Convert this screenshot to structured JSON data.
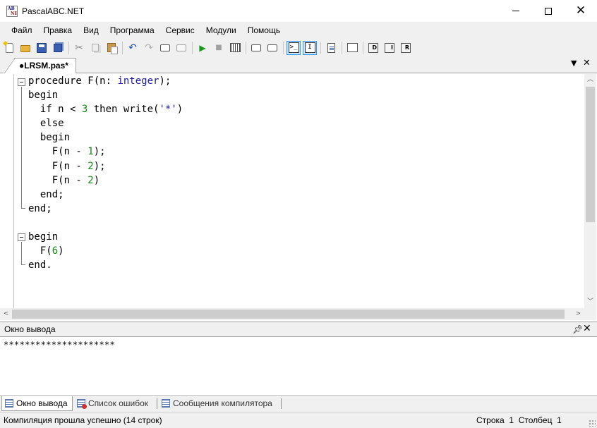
{
  "window": {
    "title": "PascalABC.NET",
    "icon_name": "pascalabc-app-icon"
  },
  "menu": {
    "items": [
      "Файл",
      "Правка",
      "Вид",
      "Программа",
      "Сервис",
      "Модули",
      "Помощь"
    ]
  },
  "toolbar": {
    "buttons": [
      {
        "name": "new-file-icon"
      },
      {
        "name": "open-folder-icon"
      },
      {
        "name": "save-icon"
      },
      {
        "name": "save-all-icon"
      },
      {
        "name": "cut-icon"
      },
      {
        "name": "copy-icon"
      },
      {
        "name": "paste-icon"
      },
      {
        "name": "undo-icon"
      },
      {
        "name": "redo-icon"
      },
      {
        "name": "navigate-back-icon"
      },
      {
        "name": "navigate-forward-icon"
      },
      {
        "name": "run-icon"
      },
      {
        "name": "stop-icon"
      },
      {
        "name": "compile-icon"
      },
      {
        "name": "debug-step-icon"
      },
      {
        "name": "debug-step-over-icon"
      },
      {
        "name": "output-window-icon",
        "pressed": true
      },
      {
        "name": "input-window-icon",
        "pressed": true
      },
      {
        "name": "format-code-icon"
      },
      {
        "name": "form-designer-icon"
      },
      {
        "name": "disassembly-d-icon"
      },
      {
        "name": "disassembly-i-icon"
      },
      {
        "name": "disassembly-r-icon"
      }
    ]
  },
  "tabs": {
    "active": "●LRSM.pas*",
    "dropdown_icon": "chevron-down-icon",
    "close_icon": "close-icon"
  },
  "editor": {
    "lines": [
      [
        {
          "t": "procedure",
          "c": "kw"
        },
        {
          "t": " F(n: ",
          "c": ""
        },
        {
          "t": "integer",
          "c": "ty"
        },
        {
          "t": ");",
          "c": ""
        }
      ],
      [
        {
          "t": "begin",
          "c": "kw"
        }
      ],
      [
        {
          "t": "  if",
          "c": "kw"
        },
        {
          "t": " n < ",
          "c": ""
        },
        {
          "t": "3",
          "c": "num"
        },
        {
          "t": " then",
          "c": "kw"
        },
        {
          "t": " write(",
          "c": ""
        },
        {
          "t": "'*'",
          "c": "str"
        },
        {
          "t": ")",
          "c": ""
        }
      ],
      [
        {
          "t": "  else",
          "c": "kw"
        }
      ],
      [
        {
          "t": "  begin",
          "c": "kw"
        }
      ],
      [
        {
          "t": "    F(n - ",
          "c": ""
        },
        {
          "t": "1",
          "c": "num"
        },
        {
          "t": ");",
          "c": ""
        }
      ],
      [
        {
          "t": "    F(n - ",
          "c": ""
        },
        {
          "t": "2",
          "c": "num"
        },
        {
          "t": ");",
          "c": ""
        }
      ],
      [
        {
          "t": "    F(n - ",
          "c": ""
        },
        {
          "t": "2",
          "c": "num"
        },
        {
          "t": ")",
          "c": ""
        }
      ],
      [
        {
          "t": "  end;",
          "c": "kw"
        }
      ],
      [
        {
          "t": "end;",
          "c": "kw"
        }
      ],
      [
        {
          "t": "",
          "c": ""
        }
      ],
      [
        {
          "t": "begin",
          "c": "kw"
        }
      ],
      [
        {
          "t": "  F(",
          "c": ""
        },
        {
          "t": "6",
          "c": "num"
        },
        {
          "t": ")",
          "c": ""
        }
      ],
      [
        {
          "t": "end.",
          "c": "kw"
        }
      ]
    ]
  },
  "output": {
    "title": "Окно вывода",
    "pin_icon": "pin-icon",
    "close_icon": "close-icon",
    "text": "*********************"
  },
  "bottom_tabs": [
    {
      "label": "Окно вывода",
      "active": true
    },
    {
      "label": "Список ошибок",
      "active": false
    },
    {
      "label": "Сообщения компилятора",
      "active": false
    }
  ],
  "status": {
    "message": "Компиляция прошла успешно (14 строк)",
    "row_label": "Строка",
    "row_value": "1",
    "col_label": "Столбец",
    "col_value": "1"
  }
}
